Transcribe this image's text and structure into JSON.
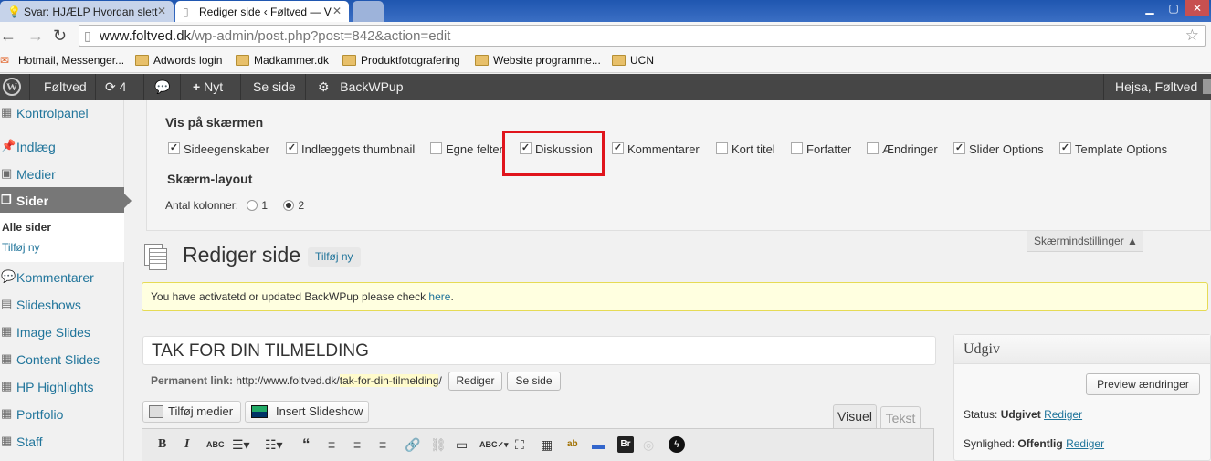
{
  "browser": {
    "tabs": [
      {
        "label": "Svar: HJÆLP Hvordan slett",
        "active": false
      },
      {
        "label": "Rediger side ‹ Føltved — V",
        "active": true
      }
    ],
    "url_host": "www.foltved.dk",
    "url_path": "/wp-admin/post.php?post=842&action=edit",
    "bookmarks": [
      "Hotmail, Messenger...",
      "Adwords login",
      "Madkammer.dk",
      "Produktfotografering",
      "Website programme...",
      "UCN"
    ]
  },
  "adminbar": {
    "site_name": "Føltved",
    "updates_count": "4",
    "new_label": "Nyt",
    "view_page": "Se side",
    "plugin": "BackWPup",
    "greeting": "Hejsa, Føltved"
  },
  "sidebar": {
    "items": [
      {
        "label": "Kontrolpanel",
        "icon": "dashboard-icon"
      },
      {
        "label": "Indlæg",
        "icon": "pin-icon"
      },
      {
        "label": "Medier",
        "icon": "media-icon"
      },
      {
        "label": "Sider",
        "icon": "pages-icon",
        "active": true
      },
      {
        "label": "Kommentarer",
        "icon": "comments-icon"
      },
      {
        "label": "Slideshows",
        "icon": "slideshow-icon"
      },
      {
        "label": "Image Slides",
        "icon": "image-icon"
      },
      {
        "label": "Content Slides",
        "icon": "content-icon"
      },
      {
        "label": "HP Highlights",
        "icon": "highlight-icon"
      },
      {
        "label": "Portfolio",
        "icon": "portfolio-icon"
      },
      {
        "label": "Staff",
        "icon": "staff-icon"
      }
    ],
    "submenu": [
      "Alle sider",
      "Tilføj ny"
    ]
  },
  "screen_options": {
    "heading": "Vis på skærmen",
    "checkboxes": [
      {
        "label": "Sideegenskaber",
        "checked": true
      },
      {
        "label": "Indlæggets thumbnail",
        "checked": true
      },
      {
        "label": "Egne felter",
        "checked": false
      },
      {
        "label": "Diskussion",
        "checked": true
      },
      {
        "label": "Kommentarer",
        "checked": true
      },
      {
        "label": "Kort titel",
        "checked": false
      },
      {
        "label": "Forfatter",
        "checked": false
      },
      {
        "label": "Ændringer",
        "checked": false
      },
      {
        "label": "Slider Options",
        "checked": true
      },
      {
        "label": "Template Options",
        "checked": true
      }
    ],
    "layout_heading": "Skærm-layout",
    "columns_label": "Antal kolonner:",
    "column_options": [
      "1",
      "2"
    ],
    "selected_columns": "2",
    "toggle_label": "Skærmindstillinger ▲"
  },
  "page": {
    "title": "Rediger side",
    "add_new": "Tilføj ny",
    "notice_text": "You have activatetd or updated BackWPup please check ",
    "notice_link": "here",
    "notice_end": ".",
    "post_title": "TAK FOR DIN TILMELDING",
    "permalink_label": "Permanent link:",
    "permalink_base": "http://www.foltved.dk/",
    "permalink_slug": "tak-for-din-tilmelding",
    "permalink_end": "/",
    "edit_button": "Rediger",
    "view_button": "Se side",
    "add_media": "Tilføj medier",
    "insert_slideshow": "Insert Slideshow",
    "tab_visual": "Visuel",
    "tab_text": "Tekst"
  },
  "publish": {
    "heading": "Udgiv",
    "preview_button": "Preview ændringer",
    "status_label": "Status:",
    "status_value": "Udgivet",
    "visibility_label": "Synlighed:",
    "visibility_value": "Offentlig",
    "edit_link": "Rediger"
  }
}
